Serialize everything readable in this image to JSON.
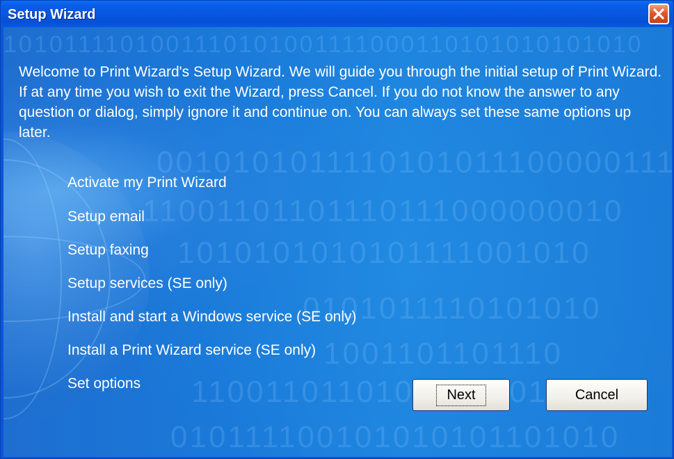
{
  "window": {
    "title": "Setup Wizard"
  },
  "intro_text": "Welcome to Print Wizard's Setup Wizard. We will guide you through the initial setup of Print Wizard. If at any time you wish to exit the Wizard, press Cancel. If you do not know the answer to any question or dialog, simply ignore it and continue on. You can always set these same options up later.",
  "steps": [
    "Activate my Print Wizard",
    "Setup email",
    "Setup faxing",
    "Setup services (SE only)",
    "Install and start a Windows service (SE only)",
    "Install a Print Wizard service (SE only)",
    "Set options"
  ],
  "buttons": {
    "next": "Next",
    "cancel": "Cancel"
  },
  "icons": {
    "close": "close-icon"
  },
  "colors": {
    "titlebar": "#0a5de6",
    "close": "#e2572c",
    "client": "#1a78d8",
    "text": "#ffffff"
  }
}
